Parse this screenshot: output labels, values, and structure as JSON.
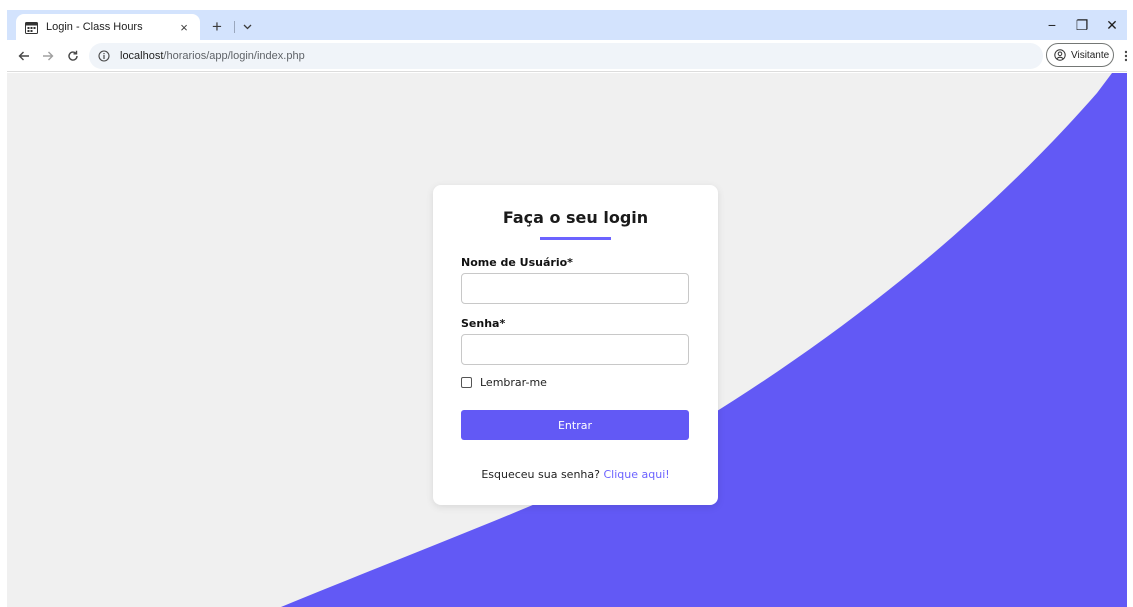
{
  "browser": {
    "tab": {
      "title": "Login - Class Hours",
      "close_label": "×"
    },
    "new_tab_label": "+",
    "url": {
      "host": "localhost",
      "path": "/horarios/app/login/index.php"
    },
    "profile_label": "Visitante",
    "window_controls": {
      "minimize": "−",
      "restore": "❐",
      "close": "✕"
    }
  },
  "page": {
    "colors": {
      "background": "#f0f0f0",
      "accent": "#6259f5",
      "wave": "#6259f5"
    },
    "login": {
      "title": "Faça o seu login",
      "username_label": "Nome de Usuário*",
      "username_value": "",
      "password_label": "Senha*",
      "password_value": "",
      "remember_label": "Lembrar-me",
      "remember_checked": false,
      "submit_label": "Entrar",
      "forgot_text": "Esqueceu sua senha?",
      "forgot_link": "Clique aqui!"
    }
  }
}
